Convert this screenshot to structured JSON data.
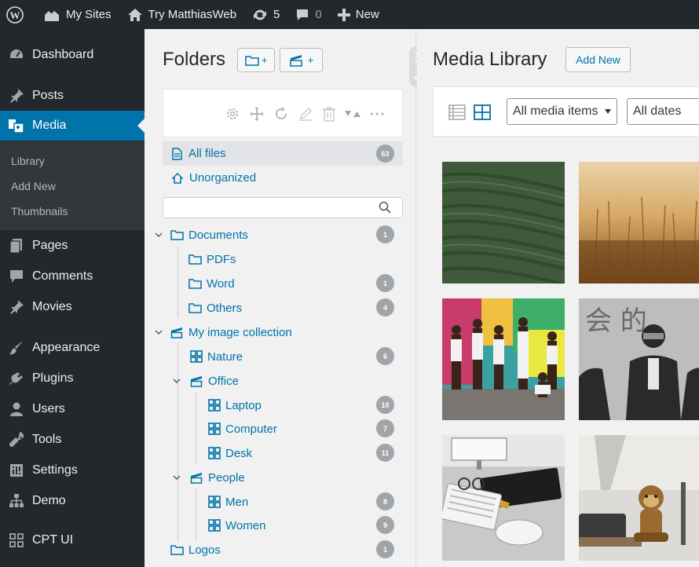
{
  "adminbar": {
    "my_sites": "My Sites",
    "site_name": "Try MatthiasWeb",
    "updates_count": "5",
    "comments_count": "0",
    "new_label": "New"
  },
  "sidebar": {
    "dashboard": "Dashboard",
    "posts": "Posts",
    "media": "Media",
    "submenu": [
      "Library",
      "Add New",
      "Thumbnails"
    ],
    "pages": "Pages",
    "comments": "Comments",
    "movies": "Movies",
    "appearance": "Appearance",
    "plugins": "Plugins",
    "users": "Users",
    "tools": "Tools",
    "settings": "Settings",
    "demo": "Demo",
    "cpt_ui": "CPT UI"
  },
  "folders": {
    "title": "Folders",
    "add_folder_label": "+",
    "add_collection_label": "+",
    "all_files": "All files",
    "all_files_count": "63",
    "unorganized": "Unorganized",
    "search_placeholder": "",
    "tree": [
      {
        "label": "Documents",
        "count": "1",
        "icon": "folder-icon"
      },
      {
        "label": "PDFs",
        "count": "",
        "icon": "folder-icon"
      },
      {
        "label": "Word",
        "count": "1",
        "icon": "folder-icon"
      },
      {
        "label": "Others",
        "count": "4",
        "icon": "folder-icon"
      },
      {
        "label": "My image collection",
        "count": "",
        "icon": "collection-icon"
      },
      {
        "label": "Nature",
        "count": "6",
        "icon": "gallery-icon"
      },
      {
        "label": "Office",
        "count": "",
        "icon": "collection-icon"
      },
      {
        "label": "Laptop",
        "count": "10",
        "icon": "gallery-icon"
      },
      {
        "label": "Computer",
        "count": "7",
        "icon": "gallery-icon"
      },
      {
        "label": "Desk",
        "count": "11",
        "icon": "gallery-icon"
      },
      {
        "label": "People",
        "count": "",
        "icon": "collection-icon"
      },
      {
        "label": "Men",
        "count": "8",
        "icon": "gallery-icon"
      },
      {
        "label": "Women",
        "count": "9",
        "icon": "gallery-icon"
      },
      {
        "label": "Logos",
        "count": "1",
        "icon": "folder-icon"
      }
    ]
  },
  "media": {
    "title": "Media Library",
    "add_new": "Add New",
    "filter_type": "All media items",
    "filter_date": "All dates"
  },
  "colors": {
    "accent": "#0073aa",
    "adminbar": "#23282d",
    "submenu_bg": "#32373c",
    "badge": "#a0a5aa"
  }
}
